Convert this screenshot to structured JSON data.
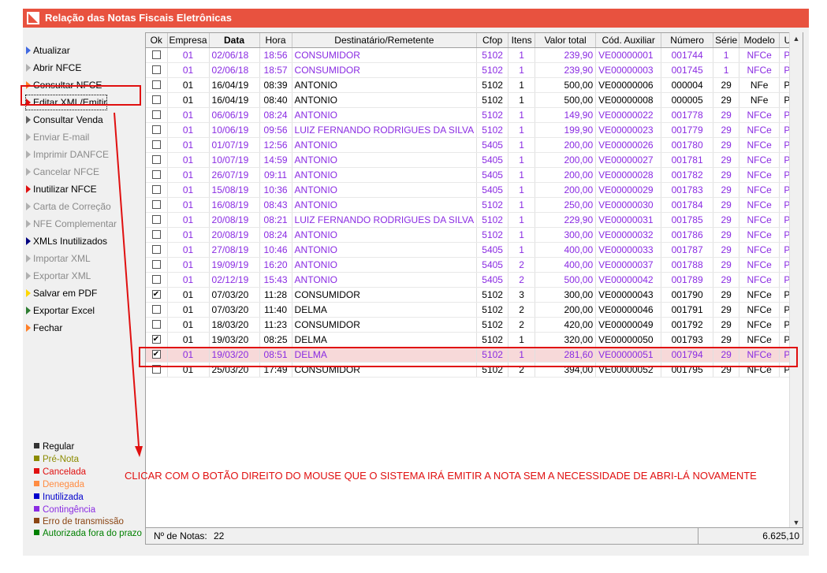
{
  "window": {
    "title": "Relação das Notas Fiscais Eletrônicas"
  },
  "sidebar": {
    "items": [
      {
        "label": "Atualizar",
        "arrow": "#4169e1",
        "state": "enabled"
      },
      {
        "label": "Abrir NFCE",
        "arrow": "#b0b0b0",
        "state": "enabled"
      },
      {
        "label": "Consultar NFCE",
        "arrow": "#ff7f27",
        "state": "enabled"
      },
      {
        "label": "Editar XML/Emitir",
        "arrow": "#e01010",
        "state": "selected"
      },
      {
        "label": "Consultar Venda",
        "arrow": "#606060",
        "state": "enabled"
      },
      {
        "label": "Enviar E-mail",
        "arrow": "#b0b0b0",
        "state": "disabled"
      },
      {
        "label": "Imprimir DANFCE",
        "arrow": "#b0b0b0",
        "state": "disabled"
      },
      {
        "label": "Cancelar NFCE",
        "arrow": "#b0b0b0",
        "state": "disabled"
      },
      {
        "label": "Inutilizar NFCE",
        "arrow": "#e01010",
        "state": "enabled"
      },
      {
        "label": "Carta de Correção",
        "arrow": "#b0b0b0",
        "state": "disabled"
      },
      {
        "label": "NFE Complementar",
        "arrow": "#b0b0b0",
        "state": "disabled"
      },
      {
        "label": "XMLs Inutilizados",
        "arrow": "#000080",
        "state": "enabled"
      },
      {
        "label": "Importar XML",
        "arrow": "#b0b0b0",
        "state": "disabled"
      },
      {
        "label": "Exportar XML",
        "arrow": "#b0b0b0",
        "state": "disabled"
      },
      {
        "label": "Salvar em PDF",
        "arrow": "#ffd700",
        "state": "enabled"
      },
      {
        "label": "Exportar Excel",
        "arrow": "#2e7d32",
        "state": "enabled"
      },
      {
        "label": "Fechar",
        "arrow": "#ff7f27",
        "state": "enabled"
      }
    ],
    "legend": [
      {
        "label": "Regular",
        "color": "#333333"
      },
      {
        "label": "Pré-Nota",
        "color": "#8b8b00"
      },
      {
        "label": "Cancelada",
        "color": "#e01010"
      },
      {
        "label": "Denegada",
        "color": "#ff8c42"
      },
      {
        "label": "Inutilizada",
        "color": "#0000cc"
      },
      {
        "label": "Contingência",
        "color": "#8a2be2"
      },
      {
        "label": "Erro de transmissão",
        "color": "#8b4513"
      },
      {
        "label": "Autorizada fora do prazo",
        "color": "#008000"
      }
    ]
  },
  "grid": {
    "headers": [
      "Ok",
      "Empresa",
      "Data",
      "Hora",
      "Destinatário/Remetente",
      "Cfop",
      "Itens",
      "Valor total",
      "Cód. Auxiliar",
      "Número",
      "Série",
      "Modelo",
      "UF"
    ],
    "rows": [
      {
        "ok": false,
        "style": "purple",
        "cells": [
          "01",
          "02/06/18",
          "18:56",
          "CONSUMIDOR",
          "5102",
          "1",
          "239,90",
          "VE00000001",
          "001744",
          "1",
          "NFCe",
          "PR"
        ]
      },
      {
        "ok": false,
        "style": "purple",
        "cells": [
          "01",
          "02/06/18",
          "18:57",
          "CONSUMIDOR",
          "5102",
          "1",
          "239,90",
          "VE00000003",
          "001745",
          "1",
          "NFCe",
          "PR"
        ]
      },
      {
        "ok": false,
        "style": "black",
        "cells": [
          "01",
          "16/04/19",
          "08:39",
          "ANTONIO",
          "5102",
          "1",
          "500,00",
          "VE00000006",
          "000004",
          "29",
          "NFe",
          "PR"
        ]
      },
      {
        "ok": false,
        "style": "black",
        "cells": [
          "01",
          "16/04/19",
          "08:40",
          "ANTONIO",
          "5102",
          "1",
          "500,00",
          "VE00000008",
          "000005",
          "29",
          "NFe",
          "PR"
        ]
      },
      {
        "ok": false,
        "style": "purple",
        "cells": [
          "01",
          "06/06/19",
          "08:24",
          "ANTONIO",
          "5102",
          "1",
          "149,90",
          "VE00000022",
          "001778",
          "29",
          "NFCe",
          "PR"
        ]
      },
      {
        "ok": false,
        "style": "purple",
        "cells": [
          "01",
          "10/06/19",
          "09:56",
          "LUIZ FERNANDO RODRIGUES DA SILVA",
          "5102",
          "1",
          "199,90",
          "VE00000023",
          "001779",
          "29",
          "NFCe",
          "PR"
        ]
      },
      {
        "ok": false,
        "style": "purple",
        "cells": [
          "01",
          "01/07/19",
          "12:56",
          "ANTONIO",
          "5405",
          "1",
          "200,00",
          "VE00000026",
          "001780",
          "29",
          "NFCe",
          "PR"
        ]
      },
      {
        "ok": false,
        "style": "purple",
        "cells": [
          "01",
          "10/07/19",
          "14:59",
          "ANTONIO",
          "5405",
          "1",
          "200,00",
          "VE00000027",
          "001781",
          "29",
          "NFCe",
          "PR"
        ]
      },
      {
        "ok": false,
        "style": "purple",
        "cells": [
          "01",
          "26/07/19",
          "09:11",
          "ANTONIO",
          "5405",
          "1",
          "200,00",
          "VE00000028",
          "001782",
          "29",
          "NFCe",
          "PR"
        ]
      },
      {
        "ok": false,
        "style": "purple",
        "cells": [
          "01",
          "15/08/19",
          "10:36",
          "ANTONIO",
          "5405",
          "1",
          "200,00",
          "VE00000029",
          "001783",
          "29",
          "NFCe",
          "PR"
        ]
      },
      {
        "ok": false,
        "style": "purple",
        "cells": [
          "01",
          "16/08/19",
          "08:43",
          "ANTONIO",
          "5102",
          "1",
          "250,00",
          "VE00000030",
          "001784",
          "29",
          "NFCe",
          "PR"
        ]
      },
      {
        "ok": false,
        "style": "purple",
        "cells": [
          "01",
          "20/08/19",
          "08:21",
          "LUIZ FERNANDO RODRIGUES DA SILVA",
          "5102",
          "1",
          "229,90",
          "VE00000031",
          "001785",
          "29",
          "NFCe",
          "PR"
        ]
      },
      {
        "ok": false,
        "style": "purple",
        "cells": [
          "01",
          "20/08/19",
          "08:24",
          "ANTONIO",
          "5102",
          "1",
          "300,00",
          "VE00000032",
          "001786",
          "29",
          "NFCe",
          "PR"
        ]
      },
      {
        "ok": false,
        "style": "purple",
        "cells": [
          "01",
          "27/08/19",
          "10:46",
          "ANTONIO",
          "5405",
          "1",
          "400,00",
          "VE00000033",
          "001787",
          "29",
          "NFCe",
          "PR"
        ]
      },
      {
        "ok": false,
        "style": "purple",
        "cells": [
          "01",
          "19/09/19",
          "16:20",
          "ANTONIO",
          "5405",
          "2",
          "400,00",
          "VE00000037",
          "001788",
          "29",
          "NFCe",
          "PR"
        ]
      },
      {
        "ok": false,
        "style": "purple",
        "cells": [
          "01",
          "02/12/19",
          "15:43",
          "ANTONIO",
          "5405",
          "2",
          "500,00",
          "VE00000042",
          "001789",
          "29",
          "NFCe",
          "PR"
        ]
      },
      {
        "ok": true,
        "style": "black",
        "cells": [
          "01",
          "07/03/20",
          "11:28",
          "CONSUMIDOR",
          "5102",
          "3",
          "300,00",
          "VE00000043",
          "001790",
          "29",
          "NFCe",
          "PR"
        ]
      },
      {
        "ok": false,
        "style": "black",
        "cells": [
          "01",
          "07/03/20",
          "11:40",
          "DELMA",
          "5102",
          "2",
          "200,00",
          "VE00000046",
          "001791",
          "29",
          "NFCe",
          "PR"
        ]
      },
      {
        "ok": false,
        "style": "black",
        "cells": [
          "01",
          "18/03/20",
          "11:23",
          "CONSUMIDOR",
          "5102",
          "2",
          "420,00",
          "VE00000049",
          "001792",
          "29",
          "NFCe",
          "PR"
        ]
      },
      {
        "ok": true,
        "style": "black",
        "cells": [
          "01",
          "19/03/20",
          "08:25",
          "DELMA",
          "5102",
          "1",
          "320,00",
          "VE00000050",
          "001793",
          "29",
          "NFCe",
          "PR"
        ]
      },
      {
        "ok": true,
        "style": "hl",
        "cells": [
          "01",
          "19/03/20",
          "08:51",
          "DELMA",
          "5102",
          "1",
          "281,60",
          "VE00000051",
          "001794",
          "29",
          "NFCe",
          "PR"
        ]
      },
      {
        "ok": false,
        "style": "black",
        "cells": [
          "01",
          "25/03/20",
          "17:49",
          "CONSUMIDOR",
          "5102",
          "2",
          "394,00",
          "VE00000052",
          "001795",
          "29",
          "NFCe",
          "PR"
        ]
      }
    ]
  },
  "status": {
    "count_label": "Nº de Notas:",
    "count_value": "22",
    "total": "6.625,10"
  },
  "annotation": "CLICAR COM O BOTÃO DIREITO DO MOUSE QUE O SISTEMA IRÁ EMITIR A NOTA SEM A NECESSIDADE DE ABRI-LÁ NOVAMENTE",
  "colors": {
    "titlebar": "#e8523f",
    "purple_text": "#8a2be2",
    "highlight_row": "#f7d9d9",
    "annotation_red": "#e01010"
  }
}
